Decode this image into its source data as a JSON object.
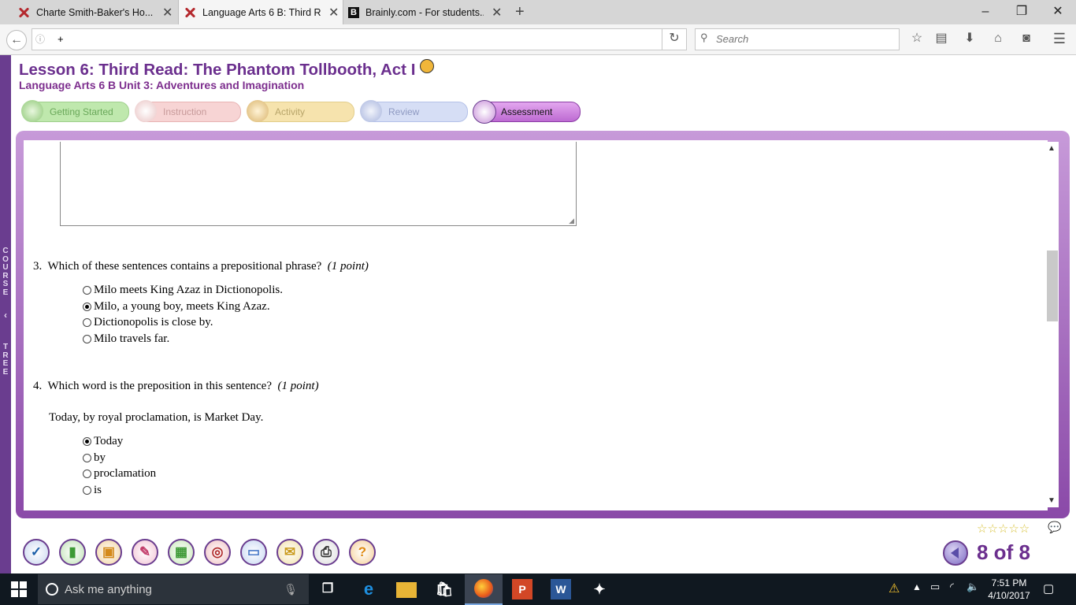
{
  "browser": {
    "tabs": [
      {
        "title": "Charte Smith-Baker's Ho...",
        "favicon": "x-logo-icon",
        "active": false
      },
      {
        "title": "Language Arts 6 B: Third R...",
        "favicon": "x-logo-icon",
        "active": true
      },
      {
        "title": "Brainly.com - For students...",
        "favicon": "brainly-b-icon",
        "active": false
      }
    ],
    "new_tab": "+",
    "url": "+",
    "search_placeholder": "Search"
  },
  "lesson": {
    "title": "Lesson 6: Third Read: The Phantom Tollbooth, Act I",
    "course": "Language Arts 6 B  Unit 3: Adventures and Imagination",
    "steps": [
      {
        "label": "Getting Started",
        "color": "#b9e6a7"
      },
      {
        "label": "Instruction",
        "color": "#f4c4c4"
      },
      {
        "label": "Activity",
        "color": "#f3dfa0"
      },
      {
        "label": "Review",
        "color": "#c9d4f2"
      },
      {
        "label": "Assessment",
        "color": "#c77bd9"
      }
    ],
    "course_tree_label": "COURSE TREE"
  },
  "questions": [
    {
      "number": "3.",
      "text": "Which of these sentences contains a prepositional phrase?",
      "points": "(1 point)",
      "options": [
        {
          "label": "Milo meets King Azaz in Dictionopolis.",
          "selected": false
        },
        {
          "label": "Milo, a young boy, meets King Azaz.",
          "selected": true
        },
        {
          "label": "Dictionopolis is close by.",
          "selected": false
        },
        {
          "label": "Milo travels far.",
          "selected": false
        }
      ]
    },
    {
      "number": "4.",
      "text": "Which word is the preposition in this sentence?",
      "points": "(1 point)",
      "prompt": "Today, by royal proclamation, is Market Day.",
      "options": [
        {
          "label": "Today",
          "selected": true
        },
        {
          "label": "by",
          "selected": false
        },
        {
          "label": "proclamation",
          "selected": false
        },
        {
          "label": "is",
          "selected": false
        }
      ]
    }
  ],
  "footer": {
    "page_indicator": "8 of 8",
    "stars": "☆☆☆☆☆",
    "tools": [
      {
        "name": "check-tool-icon",
        "glyph": "✓",
        "color": "#1a5ea8"
      },
      {
        "name": "book-tool-icon",
        "glyph": "▮",
        "color": "#3d9a35"
      },
      {
        "name": "backpack-tool-icon",
        "glyph": "▣",
        "color": "#d48a1b"
      },
      {
        "name": "pin-tool-icon",
        "glyph": "✎",
        "color": "#c23c6a"
      },
      {
        "name": "grid-tool-icon",
        "glyph": "▦",
        "color": "#3d9a35"
      },
      {
        "name": "target-tool-icon",
        "glyph": "◎",
        "color": "#b02a2a"
      },
      {
        "name": "screen-tool-icon",
        "glyph": "▭",
        "color": "#4a7ac8"
      },
      {
        "name": "notes-tool-icon",
        "glyph": "✉",
        "color": "#c99a1b"
      },
      {
        "name": "printer-tool-icon",
        "glyph": "⎙",
        "color": "#333333"
      },
      {
        "name": "help-tool-icon",
        "glyph": "?",
        "color": "#e08a10"
      }
    ]
  },
  "taskbar": {
    "search_placeholder": "Ask me anything",
    "time": "7:51 PM",
    "date": "4/10/2017"
  }
}
